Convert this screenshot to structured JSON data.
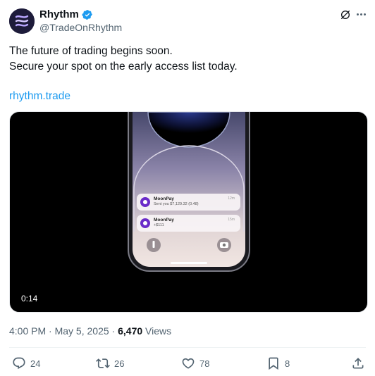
{
  "author": {
    "display_name": "Rhythm",
    "handle": "@TradeOnRhythm",
    "verified": true,
    "avatar_icon": "rhythm-logo-icon",
    "avatar_color": "#1d1b3a"
  },
  "tweet": {
    "lines": [
      "The future of trading begins soon.",
      "Secure your spot on the early access list today."
    ],
    "link": "rhythm.trade"
  },
  "media": {
    "type": "video",
    "duration": "0:14",
    "notifications": [
      {
        "title": "MoonPay",
        "time": "12m",
        "subtitle": "Sent you $7,129.32 (0.48)"
      },
      {
        "title": "MoonPay",
        "time": "15m",
        "subtitle": "+$111"
      }
    ]
  },
  "meta": {
    "time": "4:00 PM",
    "date": "May 5, 2025",
    "separator": "·",
    "views_count": "6,470",
    "views_label": "Views"
  },
  "actions": {
    "replies": "24",
    "reposts": "26",
    "likes": "78",
    "bookmarks": "8"
  },
  "colors": {
    "link": "#1d9bf0",
    "verified": "#1d9bf0",
    "secondary_text": "#536471",
    "primary_text": "#0f1419"
  }
}
